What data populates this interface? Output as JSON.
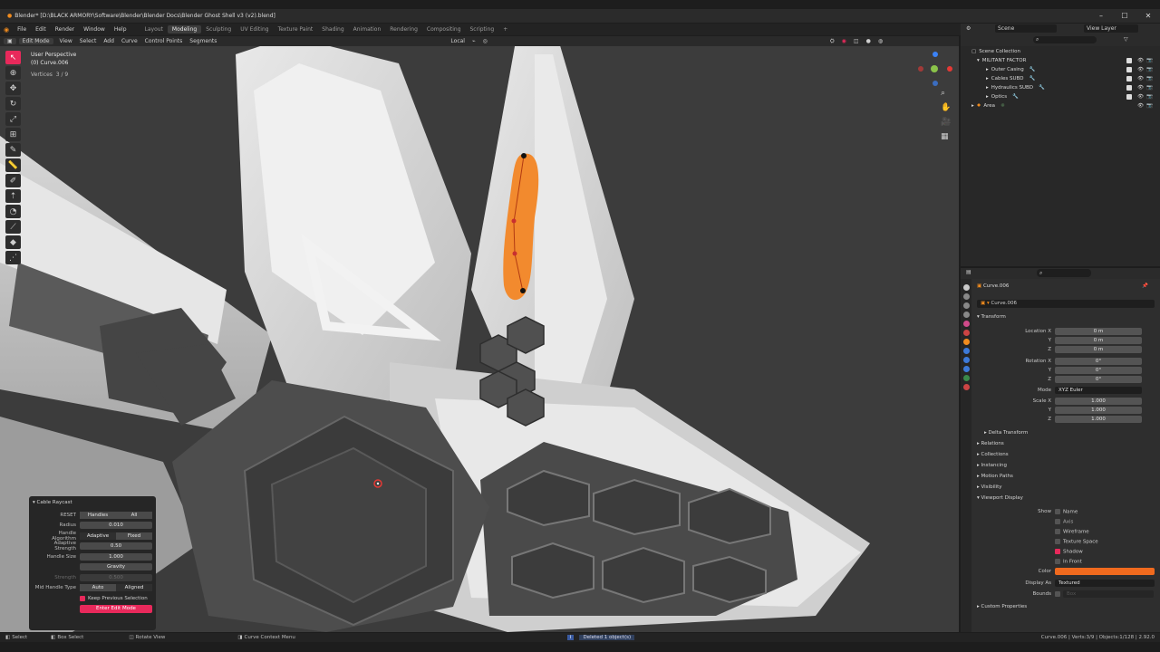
{
  "title_bar": {
    "text": "Blender* [D:\\BLACK ARMORY\\Software\\Blender\\Blender Docs\\Blender Ghost Shell v3 (v2).blend]"
  },
  "menu": {
    "items": [
      "File",
      "Edit",
      "Render",
      "Window",
      "Help"
    ]
  },
  "workspaces": {
    "tabs": [
      "Layout",
      "Modeling",
      "Sculpting",
      "UV Editing",
      "Texture Paint",
      "Shading",
      "Animation",
      "Rendering",
      "Compositing",
      "Scripting"
    ],
    "active": "Modeling"
  },
  "top_right": {
    "scene": "Scene",
    "view_layer": "View Layer"
  },
  "viewport_header": {
    "mode": "Edit Mode",
    "items": [
      "View",
      "Select",
      "Add",
      "Curve",
      "Control Points",
      "Segments"
    ],
    "pivot": "Local"
  },
  "overlay": {
    "view": "User Perspective",
    "object": "(0) Curve.006",
    "vertices_label": "Vertices",
    "vertices_value": "3 / 9"
  },
  "outliner": {
    "root": "Scene Collection",
    "collection": "MILITANT FACTOR",
    "items": [
      "Outer Casing",
      "Cables SUBD",
      "Hydraulics SUBD",
      "Optics"
    ],
    "light": "Area"
  },
  "properties": {
    "object_name": "Curve.006",
    "data_name": "Curve.006",
    "transform_label": "Transform",
    "location_label": "Location X",
    "location": [
      "0 m",
      "0 m",
      "0 m"
    ],
    "rotation_label": "Rotation X",
    "rotation": [
      "0°",
      "0°",
      "0°"
    ],
    "axis_y": "Y",
    "axis_z": "Z",
    "mode_label": "Mode",
    "mode_value": "XYZ Euler",
    "scale_label": "Scale X",
    "scale": [
      "1.000",
      "1.000",
      "1.000"
    ],
    "delta_transform": "Delta Transform",
    "sections": [
      "Relations",
      "Collections",
      "Instancing",
      "Motion Paths",
      "Visibility"
    ],
    "viewport_display": "Viewport Display",
    "show_label": "Show",
    "show_options": [
      "Name",
      "Axis",
      "Wireframe",
      "Texture Space",
      "Shadow",
      "In Front"
    ],
    "color_label": "Color",
    "display_as_label": "Display As",
    "display_as_value": "Textured",
    "bounds_label": "Bounds",
    "bounds_value": "Box",
    "custom_properties": "Custom Properties",
    "accent_color": "#e8295b",
    "object_color": "#f06a1e"
  },
  "operator_panel": {
    "title": "Cable Raycast",
    "reset_label": "RESET",
    "reset_options": [
      "Handles",
      "All"
    ],
    "radius_label": "Radius",
    "radius_value": "0.010",
    "handle_algorithm_label": "Handle Algorithm",
    "handle_algorithm_options": [
      "Adaptive",
      "Fixed"
    ],
    "adaptive_strength_label": "Adaptive Strength",
    "adaptive_strength_value": "0.50",
    "handle_size_label": "Handle Size",
    "handle_size_value": "1.000",
    "gravity_label": "Gravity",
    "strength_label": "Strength",
    "strength_value": "0.500",
    "mid_handle_label": "Mid Handle Type",
    "mid_handle_options": [
      "Auto",
      "Aligned"
    ],
    "keep_selection": "Keep Previous Selection",
    "enter_edit_mode": "Enter Edit Mode"
  },
  "status_bar": {
    "select": "Select",
    "box_select": "Box Select",
    "rotate_view": "Rotate View",
    "context_menu": "Curve Context Menu",
    "message": "Deleted 1 object(s)",
    "stats": "Curve.006 | Verts:3/9 | Objects:1/128 | 2.92.0"
  }
}
